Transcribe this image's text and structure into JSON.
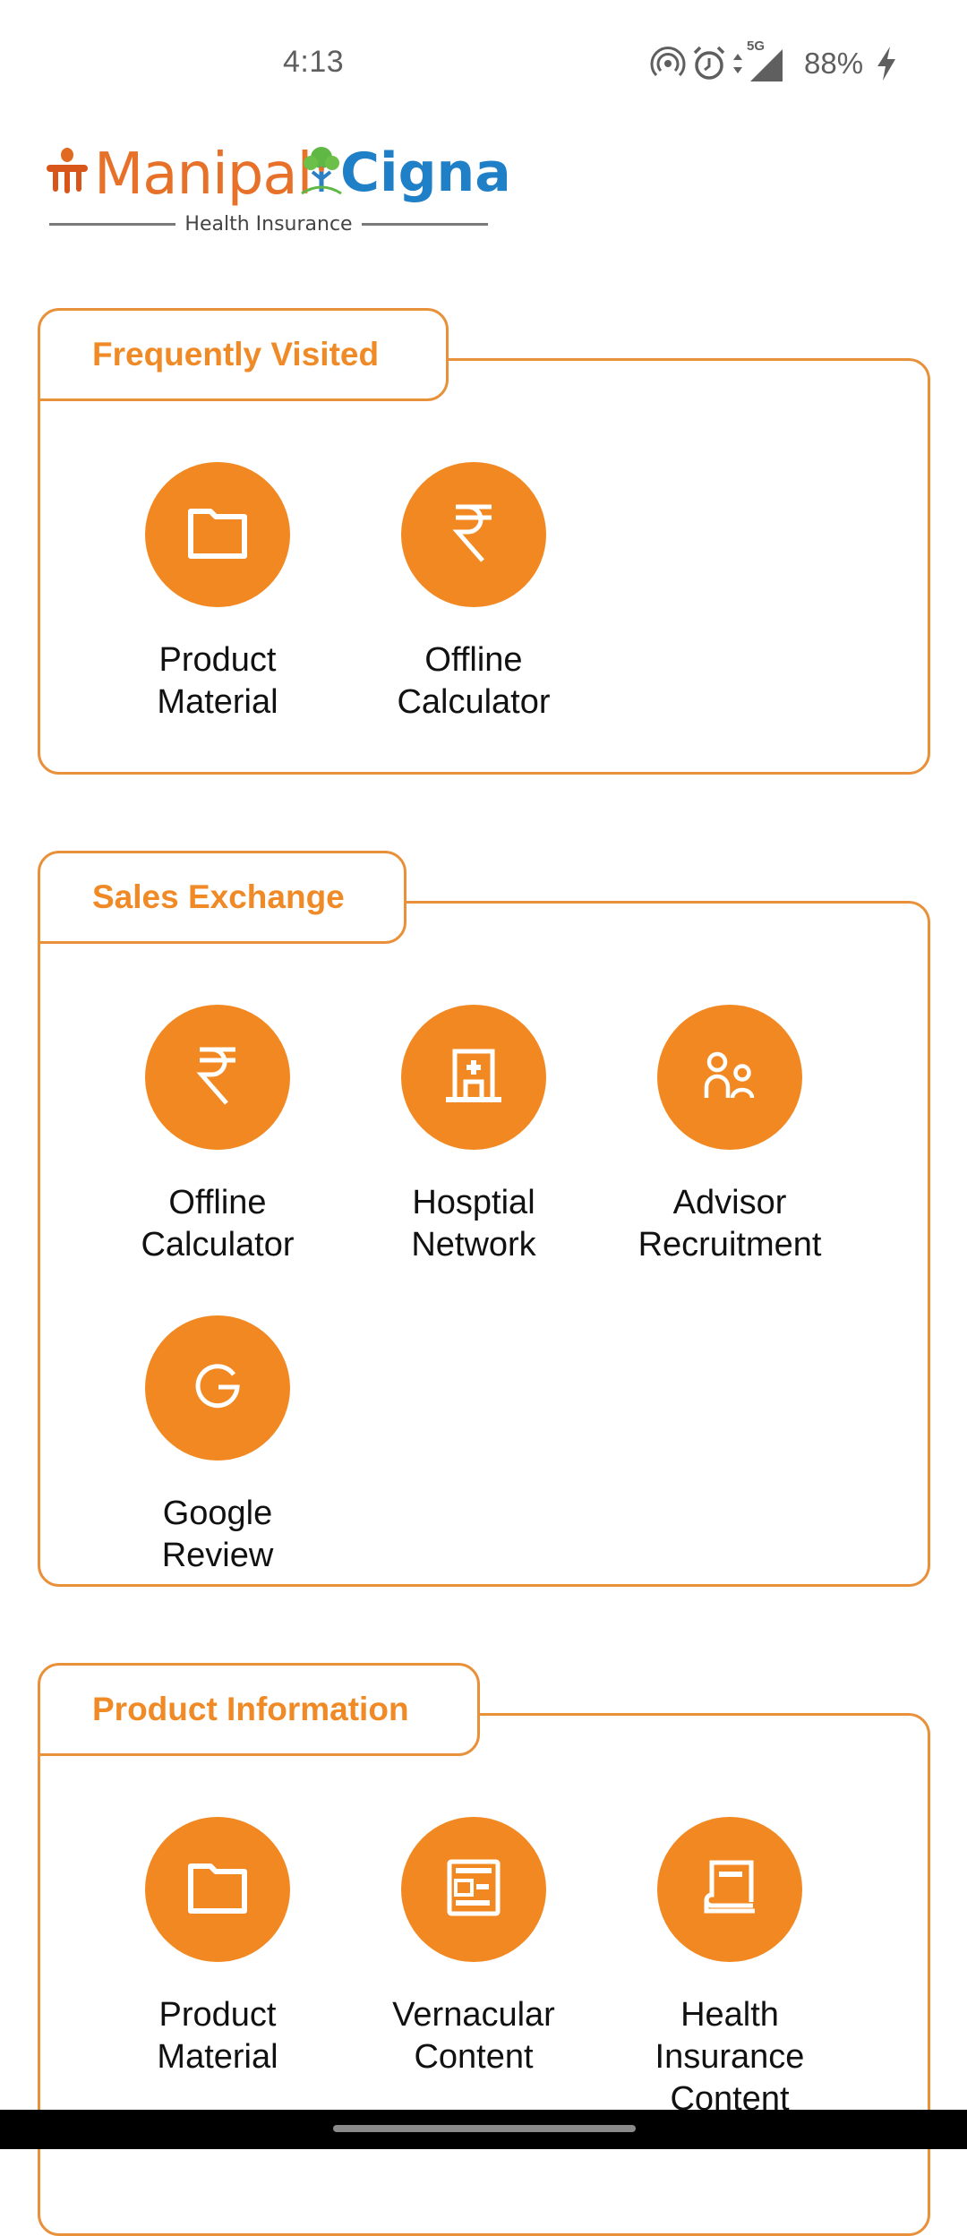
{
  "status_bar": {
    "time": "4:13",
    "network_label": "5G",
    "battery": "88%",
    "icons": [
      "hotspot-icon",
      "alarm-icon",
      "data-arrows-icon",
      "signal-icon",
      "charging-icon"
    ]
  },
  "logo": {
    "brand_left": "Manipal",
    "brand_right": "Cigna",
    "tagline": "Health Insurance",
    "colors": {
      "manipal": "#e8712a",
      "cigna": "#1f7fc7"
    }
  },
  "theme": {
    "accent": "#f28821",
    "border": "#e8913a",
    "title": "#ef8a26"
  },
  "sections": [
    {
      "title": "Frequently Visited",
      "items": [
        {
          "label": "Product\nMaterial",
          "icon": "folder-icon"
        },
        {
          "label": "Offline\nCalculator",
          "icon": "rupee-icon"
        }
      ]
    },
    {
      "title": "Sales Exchange",
      "items": [
        {
          "label": "Offline\nCalculator",
          "icon": "rupee-icon"
        },
        {
          "label": "Hosptial\nNetwork",
          "icon": "hospital-icon"
        },
        {
          "label": "Advisor\nRecruitment",
          "icon": "people-icon"
        },
        {
          "label": "Google Review",
          "icon": "google-icon"
        }
      ]
    },
    {
      "title": "Product Information",
      "items": [
        {
          "label": "Product\nMaterial",
          "icon": "folder-icon"
        },
        {
          "label": "Vernacular\nContent",
          "icon": "article-icon"
        },
        {
          "label": "Health\nInsurance\nContent",
          "icon": "book-icon"
        }
      ]
    }
  ]
}
